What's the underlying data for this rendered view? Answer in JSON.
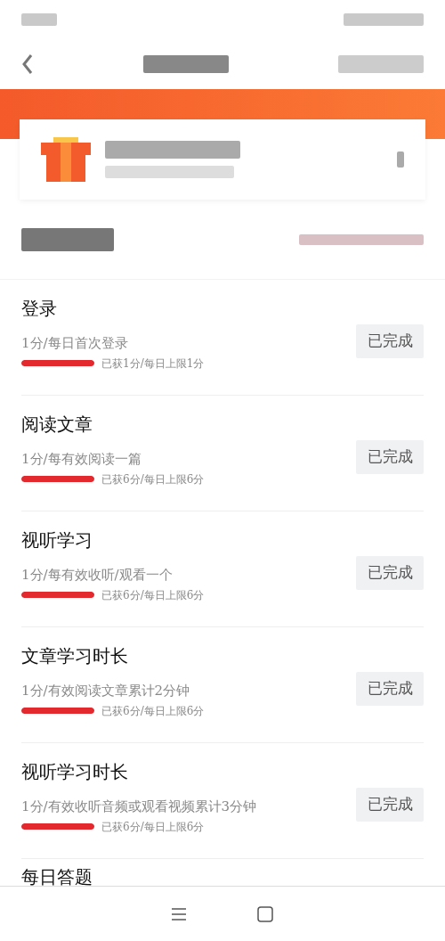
{
  "tasks": [
    {
      "title": "登录",
      "description": "1分/每日首次登录",
      "level": 1,
      "progress": "已获1分/每日上限1分",
      "button": "已完成",
      "done": true
    },
    {
      "title": "阅读文章",
      "description": "1分/每有效阅读一篇",
      "level": 1,
      "progress": "已获6分/每日上限6分",
      "button": "已完成",
      "done": true
    },
    {
      "title": "视听学习",
      "description": "1分/每有效收听/观看一个",
      "level": 1,
      "progress": "已获6分/每日上限6分",
      "button": "已完成",
      "done": true
    },
    {
      "title": "文章学习时长",
      "description": "1分/有效阅读文章累计2分钟",
      "level": 1,
      "progress": "已获6分/每日上限6分",
      "button": "已完成",
      "done": true
    },
    {
      "title": "视听学习时长",
      "description": "1分/有效收听音频或观看视频累计3分钟",
      "level": 1,
      "progress": "已获6分/每日上限6分",
      "button": "已完成",
      "done": true
    }
  ],
  "partial_task": {
    "title": "每日答题"
  }
}
